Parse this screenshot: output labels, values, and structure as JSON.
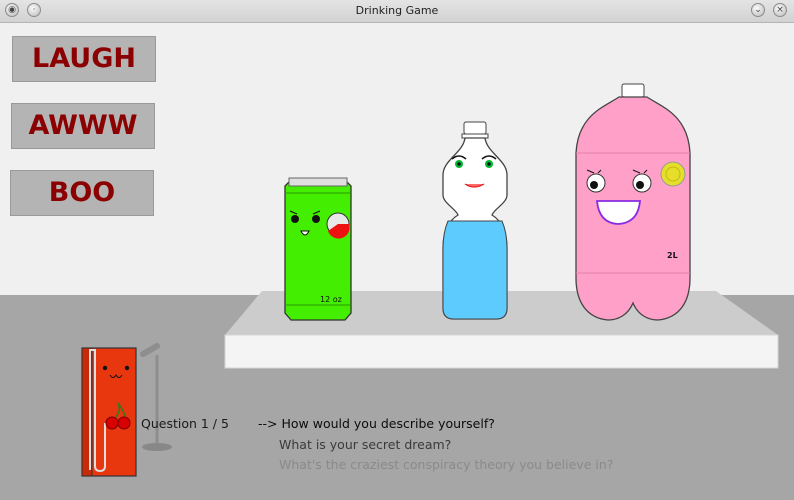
{
  "window": {
    "title": "Drinking Game"
  },
  "buttons": {
    "laugh": "LAUGH",
    "awww": "AWWW",
    "boo": "BOO"
  },
  "characters": {
    "can_label": "12 oz",
    "soda_label": "2L"
  },
  "quiz": {
    "counter": "Question 1 / 5",
    "arrow": "-->",
    "questions": [
      "How would you describe yourself?",
      "What is your secret dream?",
      "What's the craziest conspiracy theory you believe in?"
    ]
  },
  "colors": {
    "button_text": "#8b0000",
    "can": "#44ee00",
    "water": "#5ecbff",
    "soda": "#ffa0c8",
    "juice_box": "#e8360f"
  }
}
